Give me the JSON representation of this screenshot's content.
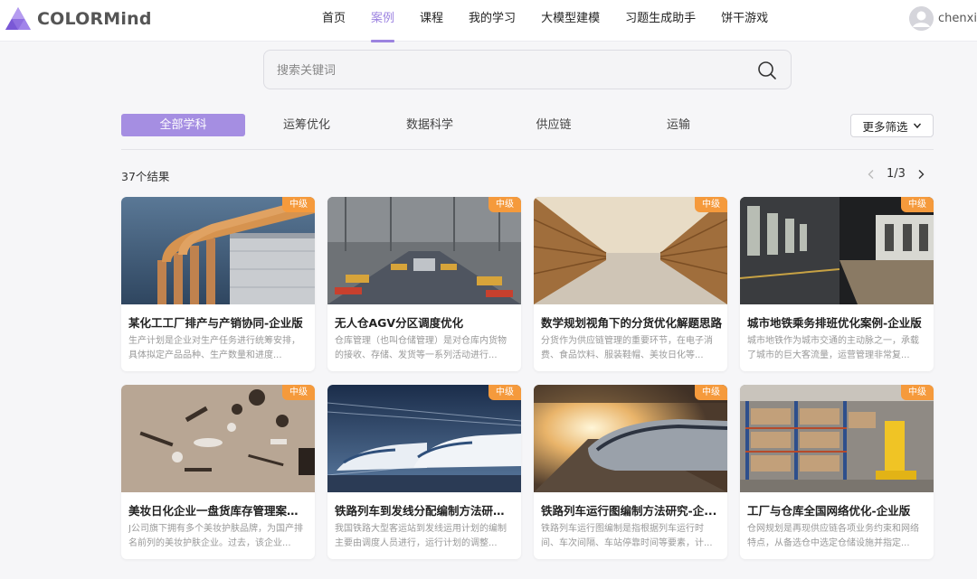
{
  "header": {
    "logo_text": "COLORMind",
    "nav": [
      {
        "label": "首页",
        "active": false
      },
      {
        "label": "案例",
        "active": true
      },
      {
        "label": "课程",
        "active": false
      },
      {
        "label": "我的学习",
        "active": false
      },
      {
        "label": "大模型建模",
        "active": false
      },
      {
        "label": "习题生成助手",
        "active": false
      },
      {
        "label": "饼干游戏",
        "active": false
      }
    ],
    "username": "chenxin"
  },
  "search": {
    "placeholder": "搜索关键词"
  },
  "filters": {
    "tabs": [
      {
        "label": "全部学科",
        "active": true
      },
      {
        "label": "运筹优化",
        "active": false
      },
      {
        "label": "数据科学",
        "active": false
      },
      {
        "label": "供应链",
        "active": false
      },
      {
        "label": "运输",
        "active": false
      }
    ],
    "more_label": "更多筛选"
  },
  "results": {
    "count_text": "37个结果",
    "page_text": "1/3"
  },
  "cards": [
    {
      "badge": "中级",
      "title": "某化工工厂排产与产销协同-企业版",
      "desc": "生产计划是企业对生产任务进行统筹安排，具体拟定产品品种、生产数量和进度..."
    },
    {
      "badge": "中级",
      "title": "无人仓AGV分区调度优化",
      "desc": "仓库管理（也叫仓储管理）是对仓库内货物的接收、存储、发货等一系列活动进行..."
    },
    {
      "badge": "中级",
      "title": "数学规划视角下的分货优化解题思路",
      "desc": "分货作为供应链管理的重要环节，在电子消费、食品饮料、服装鞋帽、美妆日化等..."
    },
    {
      "badge": "中级",
      "title": "城市地铁乘务排班优化案例-企业版",
      "desc": "城市地铁作为城市交通的主动脉之一，承载了城市的巨大客流量，运营管理非常复..."
    },
    {
      "badge": "中级",
      "title": "美妆日化企业一盘货库存管理案例...",
      "desc": "J公司旗下拥有多个美妆护肤品牌，为国产排名前列的美妆护肤企业。过去，该企业..."
    },
    {
      "badge": "中级",
      "title": "铁路列车到发线分配编制方法研究...",
      "desc": "我国铁路大型客运站到发线运用计划的编制主要由调度人员进行，运行计划的调整..."
    },
    {
      "badge": "中级",
      "title": "铁路列车运行图编制方法研究-企...",
      "desc": "铁路列车运行图编制是指根据列车运行时间、车次间隔、车站停靠时间等要素，计..."
    },
    {
      "badge": "中级",
      "title": "工厂与仓库全国网络优化-企业版",
      "desc": "仓网规划是再现供应链各项业务约束和网络特点，从备选仓中选定仓储设施并指定..."
    }
  ],
  "colors": {
    "accent": "#9c83e0",
    "tab_active_bg": "#a58ee2",
    "badge": "#f59a3c"
  }
}
